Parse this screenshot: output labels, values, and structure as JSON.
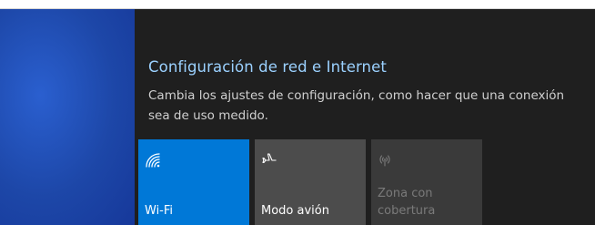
{
  "flyout": {
    "title": "Configuración de red e Internet",
    "description": "Cambia los ajustes de configuración, como hacer que una conexión sea de uso medido."
  },
  "quick_actions": [
    {
      "label": "Wi-Fi",
      "icon": "wifi-icon",
      "state": "on",
      "color": "#0078d7"
    },
    {
      "label": "Modo avión",
      "icon": "airplane-icon",
      "state": "off",
      "color": "#4c4c4c"
    },
    {
      "label": "Zona con cobertura",
      "icon": "hotspot-icon",
      "state": "disabled",
      "color": "#3a3a3a"
    }
  ],
  "colors": {
    "accent": "#0078d7",
    "title_link": "#9bd1ff",
    "flyout_bg": "#1f1f1f"
  }
}
